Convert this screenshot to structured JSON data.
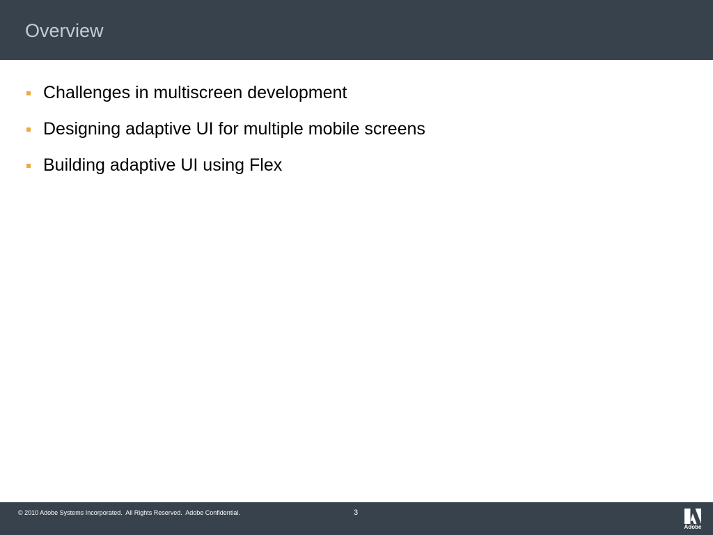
{
  "slide": {
    "title": "Overview",
    "bullets": [
      "Challenges in multiscreen development",
      "Designing adaptive UI for multiple mobile screens",
      "Building adaptive UI using Flex"
    ]
  },
  "footer": {
    "copyright": "© 2010 Adobe Systems Incorporated.  All Rights Reserved.  Adobe Confidential.",
    "page_number": "3",
    "logo_text": "Adobe",
    "logo_icon": "adobe-logo-icon"
  },
  "colors": {
    "header_background": "#37424d",
    "title_text": "#c4cbd2",
    "bullet_marker": "#f0a93c",
    "body_text": "#000000",
    "footer_background": "#37424d",
    "footer_text": "#ffffff"
  }
}
